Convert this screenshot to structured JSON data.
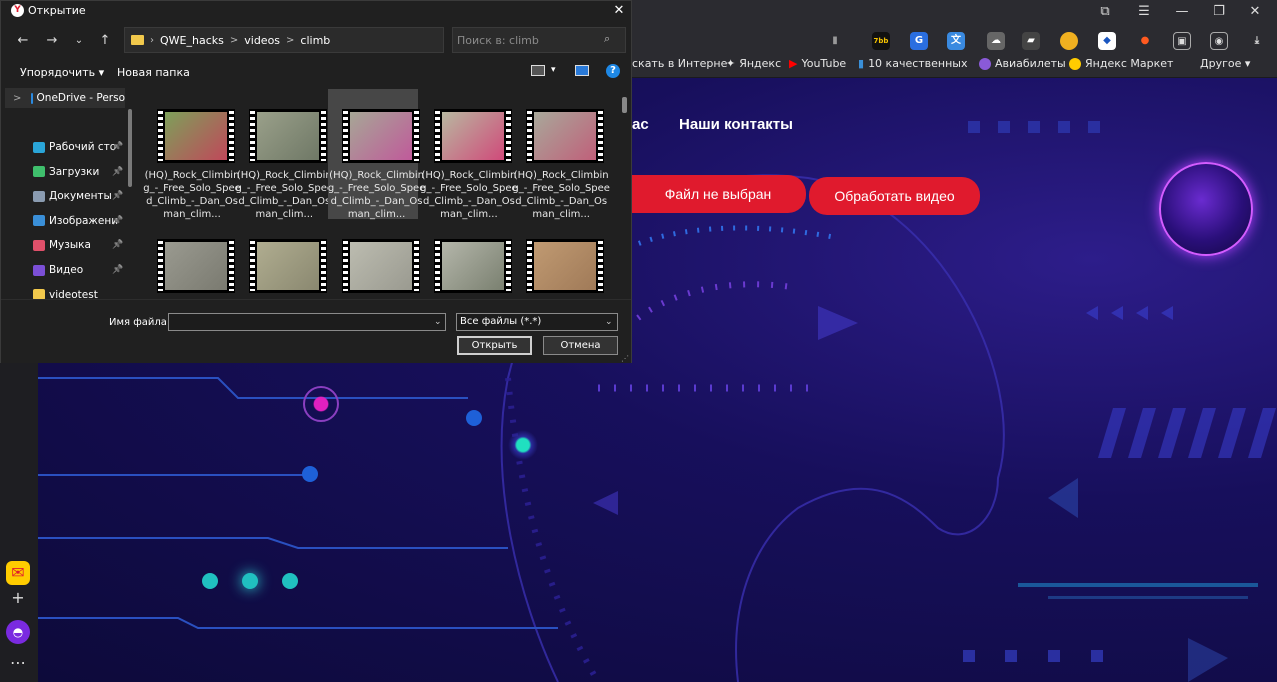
{
  "dialog": {
    "title": "Открытие",
    "logo": "Y",
    "address": {
      "segments": [
        "QWE_hacks",
        "videos",
        "climb"
      ],
      "separator": ">"
    },
    "search_placeholder": "Поиск в: climb",
    "toolbar": {
      "organize": "Упорядочить ▾",
      "new_folder": "Новая папка",
      "view_dd": "▾"
    },
    "sidebar": [
      {
        "label": "OneDrive - Perso",
        "icon": "cloud-icon",
        "color": "#2b8ae0",
        "pinned": false,
        "chevron": ">"
      },
      {
        "label": "Рабочий сто",
        "icon": "desktop-icon",
        "color": "#2aa5d8",
        "pinned": true
      },
      {
        "label": "Загрузки",
        "icon": "download-icon",
        "color": "#3fbf6c",
        "pinned": true
      },
      {
        "label": "Документы",
        "icon": "documents-icon",
        "color": "#8a9bb0",
        "pinned": true
      },
      {
        "label": "Изображени",
        "icon": "pictures-icon",
        "color": "#3a8fd8",
        "pinned": true
      },
      {
        "label": "Музыка",
        "icon": "music-icon",
        "color": "#e0506a",
        "pinned": true
      },
      {
        "label": "Видео",
        "icon": "video-icon",
        "color": "#7b4fd6",
        "pinned": true
      },
      {
        "label": "videotest",
        "icon": "folder-icon",
        "color": "#f2c94c",
        "pinned": false
      }
    ],
    "files": [
      {
        "name": "(HQ)_Rock_Climbing_-_Free_Solo_Speed_Climb_-_Dan_Osman_clim...",
        "colors": [
          "#7da05a",
          "#c0485a"
        ]
      },
      {
        "name": "(HQ)_Rock_Climbing_-_Free_Solo_Speed_Climb_-_Dan_Osman_clim...",
        "colors": [
          "#9aa08a",
          "#6f7866"
        ]
      },
      {
        "name": "(HQ)_Rock_Climbing_-_Free_Solo_Speed_Climb_-_Dan_Osman_clim...",
        "colors": [
          "#a6a796",
          "#c05a9a"
        ],
        "selected": true
      },
      {
        "name": "(HQ)_Rock_Climbing_-_Free_Solo_Speed_Climb_-_Dan_Osman_clim...",
        "colors": [
          "#b8b8a0",
          "#d04a7a"
        ]
      },
      {
        "name": "(HQ)_Rock_Climbing_-_Free_Solo_Speed_Climb_-_Dan_Osman_clim...",
        "colors": [
          "#a8a89a",
          "#c0607a"
        ]
      },
      {
        "name": "",
        "colors": [
          "#9a9a90",
          "#7a7a70"
        ]
      },
      {
        "name": "",
        "colors": [
          "#b0ad90",
          "#8a8870"
        ]
      },
      {
        "name": "",
        "colors": [
          "#bcbcb0",
          "#9a9a90"
        ]
      },
      {
        "name": "",
        "colors": [
          "#b4b6aa",
          "#7a8070"
        ]
      },
      {
        "name": "",
        "colors": [
          "#c09a72",
          "#a07a58"
        ]
      }
    ],
    "filename_label": "Имя файла:",
    "filename_value": "",
    "filetype": "Все файлы (*.*)",
    "open_button": "Открыть",
    "cancel_button": "Отмена"
  },
  "browser": {
    "bookmarks": [
      {
        "label": "скать в Интерне",
        "color": ""
      },
      {
        "label": "Яндекс",
        "color": "#ffffff"
      },
      {
        "label": "YouTube",
        "color": "#ff0000"
      },
      {
        "label": "10 качественных",
        "color": "#3a8fd8"
      },
      {
        "label": "Авиабилеты",
        "color": "#8a5ad8"
      },
      {
        "label": "Яндекс Маркет",
        "color": "#ffcc00"
      },
      {
        "label": "Другое ▾",
        "color": ""
      }
    ],
    "sidebar_buttons": [
      "⋯",
      "+"
    ]
  },
  "page": {
    "nav_partial": "ас",
    "nav_contacts": "Наши контакты",
    "file_not_chosen": "Файл не выбран",
    "process_video": "Обработать видео",
    "accent": "#e01a2d"
  }
}
